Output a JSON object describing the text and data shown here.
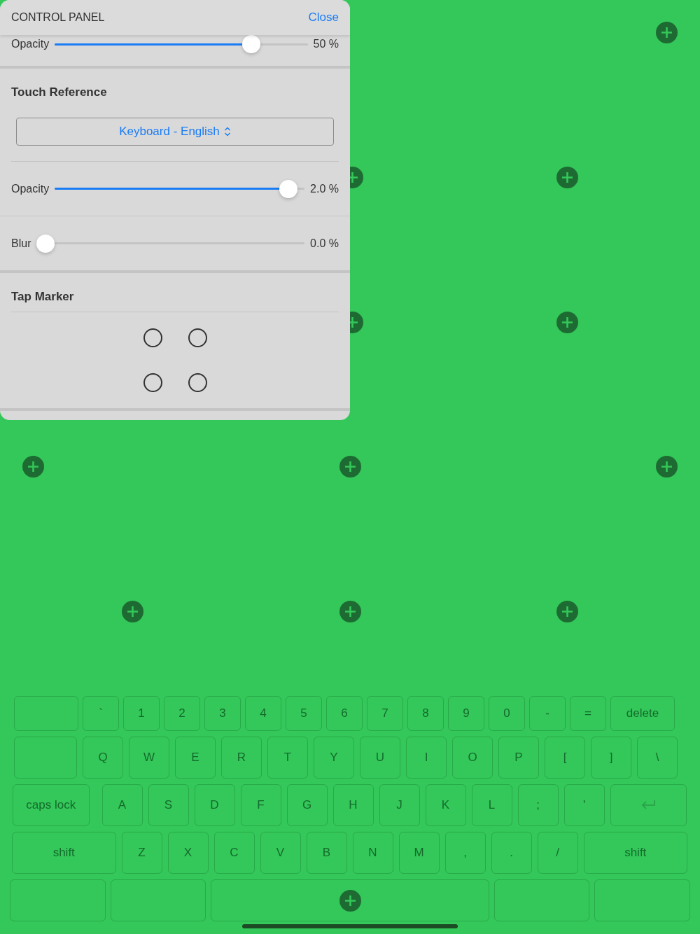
{
  "panel": {
    "title": "CONTROL PANEL",
    "close_button": "Close",
    "sections": [
      {
        "rows": [
          {
            "kind": "slider",
            "label": "Opacity",
            "level": 0.8,
            "reading": "50 %"
          }
        ]
      },
      {
        "title": "Touch Reference",
        "rows": [
          {
            "kind": "dropdown",
            "value": "Keyboard - English"
          },
          {
            "kind": "slider",
            "label": "Opacity",
            "level": 0.97,
            "reading": "2.0 %"
          },
          {
            "kind": "slider",
            "label": "Blur",
            "level": 0,
            "reading": "0.0 %"
          }
        ]
      },
      {
        "title": "Tap Marker",
        "rows": [
          {
            "kind": "markers",
            "markers": [
              {
                "kind": "ring"
              },
              {
                "kind": "ring"
              },
              {
                "kind": "ring"
              },
              {
                "kind": "ring"
              }
            ]
          }
        ]
      }
    ]
  },
  "keyboard": {
    "rows": [
      {
        "keys": [
          {
            "kind": "wide"
          },
          {
            "kind": "key",
            "label": "`"
          },
          {
            "kind": "key",
            "label": "1"
          },
          {
            "kind": "key",
            "label": "2"
          },
          {
            "kind": "key",
            "label": "3"
          },
          {
            "kind": "key",
            "label": "4"
          },
          {
            "kind": "key",
            "label": "5"
          },
          {
            "kind": "key",
            "label": "6"
          },
          {
            "kind": "key",
            "label": "7"
          },
          {
            "kind": "key",
            "label": "8"
          },
          {
            "kind": "key",
            "label": "9"
          },
          {
            "kind": "key",
            "label": "0"
          },
          {
            "kind": "key",
            "label": "-"
          },
          {
            "kind": "key",
            "label": "="
          },
          {
            "kind": "wide",
            "label": "delete"
          }
        ]
      },
      {
        "keys": [
          {
            "kind": "wide"
          },
          {
            "kind": "key",
            "label": "Q"
          },
          {
            "kind": "key",
            "label": "W"
          },
          {
            "kind": "key",
            "label": "E"
          },
          {
            "kind": "key",
            "label": "R"
          },
          {
            "kind": "key",
            "label": "T"
          },
          {
            "kind": "key",
            "label": "Y"
          },
          {
            "kind": "key",
            "label": "U"
          },
          {
            "kind": "key",
            "label": "I"
          },
          {
            "kind": "key",
            "label": "O"
          },
          {
            "kind": "key",
            "label": "P"
          },
          {
            "kind": "key",
            "label": "["
          },
          {
            "kind": "key",
            "label": "]"
          },
          {
            "kind": "key",
            "label": "\\"
          }
        ]
      },
      {
        "keys": [
          {
            "kind": "wide",
            "label": "caps lock"
          },
          {
            "kind": "key",
            "label": "A"
          },
          {
            "kind": "key",
            "label": "S"
          },
          {
            "kind": "key",
            "label": "D"
          },
          {
            "kind": "key",
            "label": "F"
          },
          {
            "kind": "key",
            "label": "G"
          },
          {
            "kind": "key",
            "label": "H"
          },
          {
            "kind": "key",
            "label": "J"
          },
          {
            "kind": "key",
            "label": "K"
          },
          {
            "kind": "key",
            "label": "L"
          },
          {
            "kind": "key",
            "label": ";"
          },
          {
            "kind": "key",
            "label": "'"
          },
          {
            "kind": "return"
          }
        ]
      },
      {
        "keys": [
          {
            "kind": "wide",
            "label": "shift"
          },
          {
            "kind": "key",
            "label": "Z"
          },
          {
            "kind": "key",
            "label": "X"
          },
          {
            "kind": "key",
            "label": "C"
          },
          {
            "kind": "key",
            "label": "V"
          },
          {
            "kind": "key",
            "label": "B"
          },
          {
            "kind": "key",
            "label": "N"
          },
          {
            "kind": "key",
            "label": "M"
          },
          {
            "kind": "key",
            "label": ","
          },
          {
            "kind": "key",
            "label": "."
          },
          {
            "kind": "key",
            "label": "/"
          },
          {
            "kind": "wide",
            "label": "shift"
          }
        ]
      },
      {
        "keys": [
          {
            "kind": "bottom"
          },
          {
            "kind": "bottom"
          },
          {
            "kind": "space"
          },
          {
            "kind": "bottom"
          },
          {
            "kind": "bottom"
          }
        ]
      }
    ]
  }
}
